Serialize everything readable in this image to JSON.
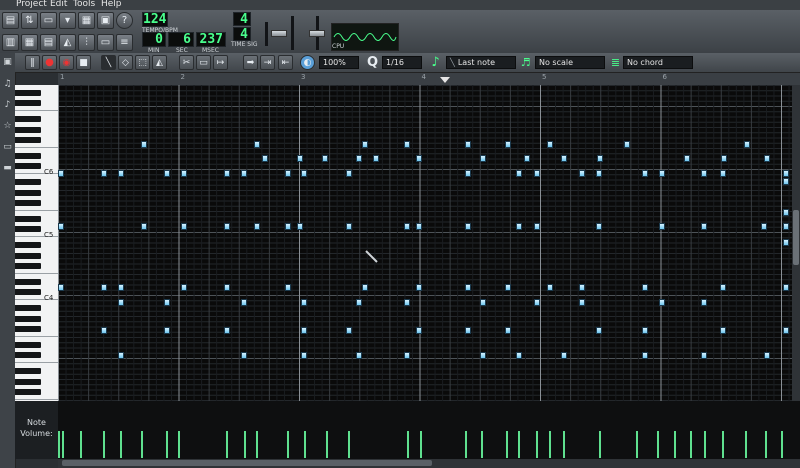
{
  "menu": [
    "Project",
    "Edit",
    "Tools",
    "Help"
  ],
  "tempo": {
    "value": "124",
    "caption": "TEMPO/BPM"
  },
  "time": {
    "min": "0",
    "sec": "6",
    "msec": "237",
    "min_caption": "MIN",
    "sec_caption": "SEC",
    "msec_caption": "MSEC"
  },
  "time_sig": {
    "numerator": "4",
    "denominator": "4",
    "caption": "TIME SIG"
  },
  "cpu_label": "CPU",
  "cpu_level": 0.35,
  "piano_toolbar": {
    "zoom": "100%",
    "quantize": "1/16",
    "note_length": "Last note",
    "scale": "No scale",
    "chord": "No chord"
  },
  "ruler": [
    "1",
    "2",
    "3",
    "4",
    "5",
    "6"
  ],
  "key_labels": [
    "C6",
    "C5",
    "C4"
  ],
  "volume_label": {
    "line1": "Note",
    "line2": "Volume:"
  },
  "accent": "#49ff8d",
  "note_color": "#8fd3f4"
}
